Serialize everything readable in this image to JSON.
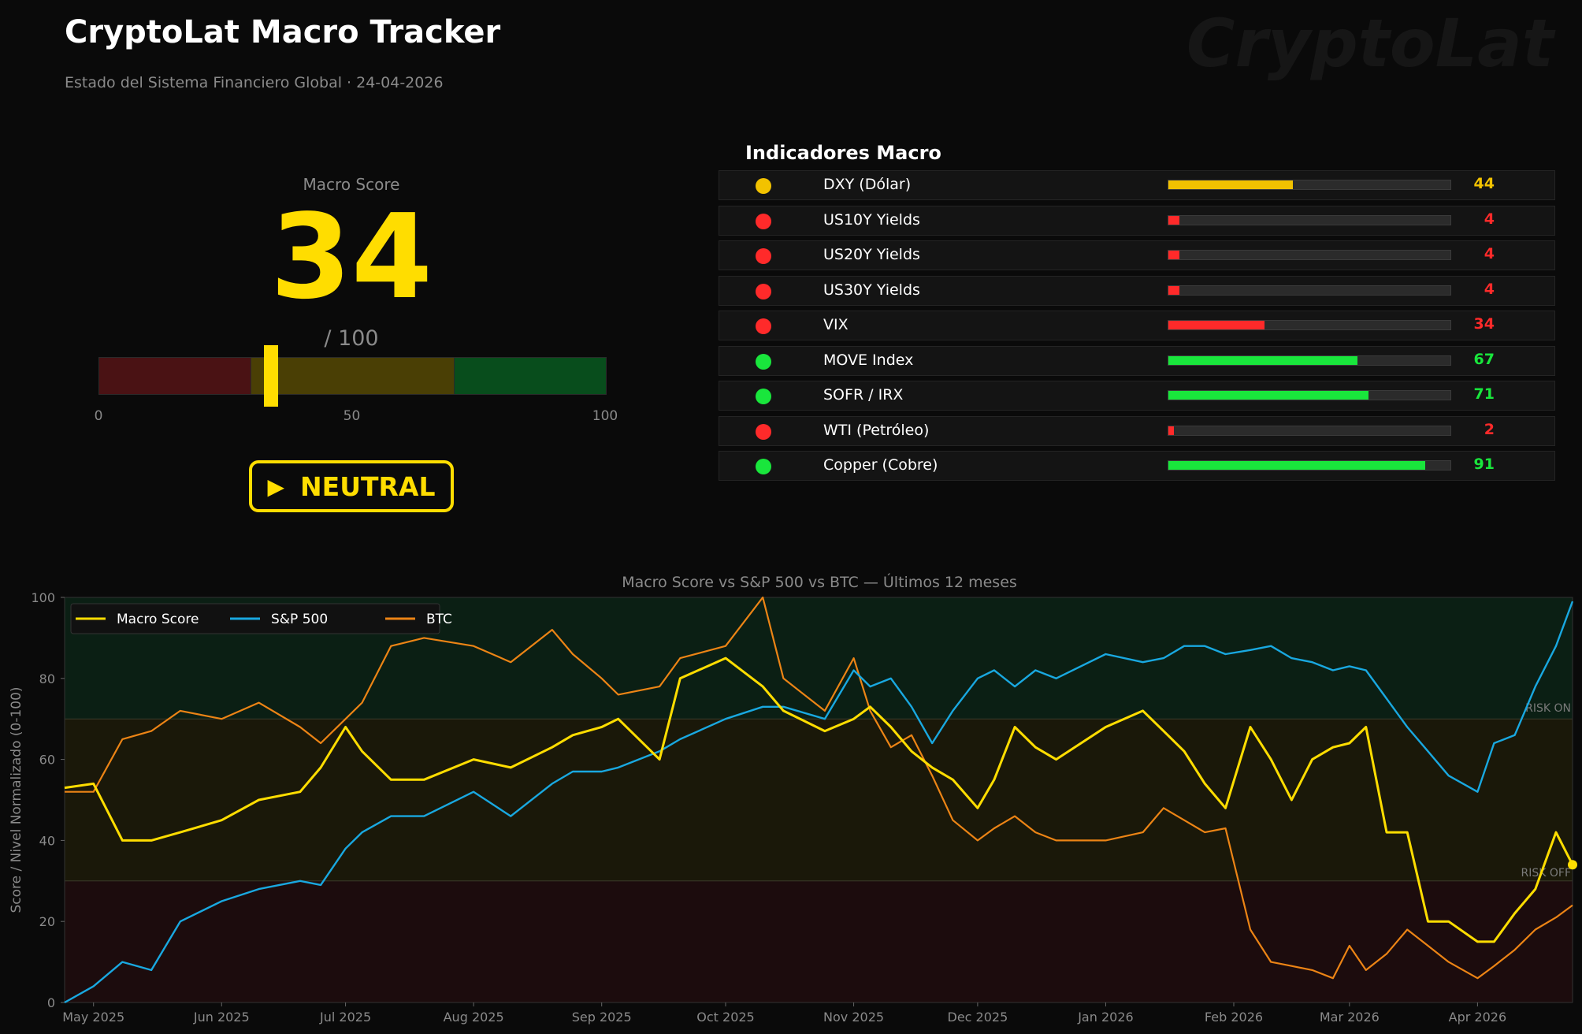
{
  "header": {
    "title": "CryptoLat Macro Tracker",
    "subtitle": "Estado del Sistema Financiero Global  ·  24-04-2026",
    "watermark": "CryptoLat"
  },
  "score": {
    "label": "Macro Score",
    "value": 34,
    "max_label": "/ 100",
    "gauge_ticks": [
      "0",
      "50",
      "100"
    ],
    "status": "NEUTRAL",
    "status_icon": "play-triangle-icon",
    "accent": "#ffdd00"
  },
  "indicators": {
    "title": "Indicadores Macro",
    "items": [
      {
        "name": "DXY (Dólar)",
        "value": 44,
        "color": "#f2c200"
      },
      {
        "name": "US10Y Yields",
        "value": 4,
        "color": "#ff2a2a"
      },
      {
        "name": "US20Y Yields",
        "value": 4,
        "color": "#ff2a2a"
      },
      {
        "name": "US30Y Yields",
        "value": 4,
        "color": "#ff2a2a"
      },
      {
        "name": "VIX",
        "value": 34,
        "color": "#ff2a2a"
      },
      {
        "name": "MOVE Index",
        "value": 67,
        "color": "#19e63c"
      },
      {
        "name": "SOFR / IRX",
        "value": 71,
        "color": "#19e63c"
      },
      {
        "name": "WTI (Petróleo)",
        "value": 2,
        "color": "#ff2a2a"
      },
      {
        "name": "Copper (Cobre)",
        "value": 91,
        "color": "#19e63c"
      }
    ]
  },
  "chart_data": {
    "type": "line",
    "title": "Macro Score vs S&P 500 vs BTC — Últimos 12 meses",
    "ylabel": "Score / Nivel Normalizado (0-100)",
    "xlabel": "",
    "ylim": [
      0,
      100
    ],
    "yticks": [
      0,
      20,
      40,
      60,
      80,
      100
    ],
    "xlim": [
      "2025-04-24",
      "2026-04-24"
    ],
    "xticks": [
      {
        "date": "2025-05-01",
        "label": "May 2025"
      },
      {
        "date": "2025-06-01",
        "label": "Jun 2025"
      },
      {
        "date": "2025-07-01",
        "label": "Jul 2025"
      },
      {
        "date": "2025-08-01",
        "label": "Aug 2025"
      },
      {
        "date": "2025-09-01",
        "label": "Sep 2025"
      },
      {
        "date": "2025-10-01",
        "label": "Oct 2025"
      },
      {
        "date": "2025-11-01",
        "label": "Nov 2025"
      },
      {
        "date": "2025-12-01",
        "label": "Dec 2025"
      },
      {
        "date": "2026-01-01",
        "label": "Jan 2026"
      },
      {
        "date": "2026-02-01",
        "label": "Feb 2026"
      },
      {
        "date": "2026-03-01",
        "label": "Mar 2026"
      },
      {
        "date": "2026-04-01",
        "label": "Apr 2026"
      }
    ],
    "zones": [
      {
        "from": 70,
        "to": 100,
        "color": "#0b1f14",
        "label": "RISK ON"
      },
      {
        "from": 30,
        "to": 70,
        "color": "#1a1809",
        "label": ""
      },
      {
        "from": 0,
        "to": 30,
        "color": "#1c0c0d",
        "label": "RISK OFF"
      }
    ],
    "legend_position": "top-left",
    "series": [
      {
        "name": "Macro Score",
        "color": "#ffdd00",
        "width": 3,
        "x": [
          "2025-04-24",
          "2025-05-01",
          "2025-05-08",
          "2025-05-15",
          "2025-05-22",
          "2025-06-01",
          "2025-06-10",
          "2025-06-20",
          "2025-06-25",
          "2025-07-01",
          "2025-07-05",
          "2025-07-12",
          "2025-07-20",
          "2025-08-01",
          "2025-08-10",
          "2025-08-20",
          "2025-08-25",
          "2025-09-01",
          "2025-09-05",
          "2025-09-15",
          "2025-09-20",
          "2025-10-01",
          "2025-10-10",
          "2025-10-15",
          "2025-10-25",
          "2025-11-01",
          "2025-11-05",
          "2025-11-10",
          "2025-11-15",
          "2025-11-20",
          "2025-11-25",
          "2025-12-01",
          "2025-12-05",
          "2025-12-10",
          "2025-12-15",
          "2025-12-20",
          "2026-01-01",
          "2026-01-10",
          "2026-01-15",
          "2026-01-20",
          "2026-01-25",
          "2026-01-30",
          "2026-02-05",
          "2026-02-10",
          "2026-02-15",
          "2026-02-20",
          "2026-02-25",
          "2026-03-01",
          "2026-03-05",
          "2026-03-10",
          "2026-03-15",
          "2026-03-20",
          "2026-03-25",
          "2026-04-01",
          "2026-04-05",
          "2026-04-10",
          "2026-04-15",
          "2026-04-20",
          "2026-04-24"
        ],
        "y": [
          53,
          54,
          40,
          40,
          42,
          45,
          50,
          52,
          58,
          68,
          62,
          55,
          55,
          60,
          58,
          63,
          66,
          68,
          70,
          60,
          80,
          85,
          78,
          72,
          67,
          70,
          73,
          68,
          62,
          58,
          55,
          48,
          55,
          68,
          63,
          60,
          68,
          72,
          67,
          62,
          54,
          48,
          68,
          60,
          50,
          60,
          63,
          64,
          68,
          42,
          42,
          20,
          20,
          15,
          15,
          22,
          28,
          42,
          34
        ]
      },
      {
        "name": "S&P 500",
        "color": "#19a8e0",
        "width": 2.4,
        "x": [
          "2025-04-24",
          "2025-05-01",
          "2025-05-08",
          "2025-05-15",
          "2025-05-22",
          "2025-06-01",
          "2025-06-10",
          "2025-06-20",
          "2025-06-25",
          "2025-07-01",
          "2025-07-05",
          "2025-07-12",
          "2025-07-20",
          "2025-08-01",
          "2025-08-10",
          "2025-08-20",
          "2025-08-25",
          "2025-09-01",
          "2025-09-05",
          "2025-09-15",
          "2025-09-20",
          "2025-10-01",
          "2025-10-10",
          "2025-10-15",
          "2025-10-25",
          "2025-11-01",
          "2025-11-05",
          "2025-11-10",
          "2025-11-15",
          "2025-11-20",
          "2025-11-25",
          "2025-12-01",
          "2025-12-05",
          "2025-12-10",
          "2025-12-15",
          "2025-12-20",
          "2026-01-01",
          "2026-01-10",
          "2026-01-15",
          "2026-01-20",
          "2026-01-25",
          "2026-01-30",
          "2026-02-05",
          "2026-02-10",
          "2026-02-15",
          "2026-02-20",
          "2026-02-25",
          "2026-03-01",
          "2026-03-05",
          "2026-03-10",
          "2026-03-15",
          "2026-03-20",
          "2026-03-25",
          "2026-04-01",
          "2026-04-05",
          "2026-04-10",
          "2026-04-15",
          "2026-04-20",
          "2026-04-24"
        ],
        "y": [
          0,
          4,
          10,
          8,
          20,
          25,
          28,
          30,
          29,
          38,
          42,
          46,
          46,
          52,
          46,
          54,
          57,
          57,
          58,
          62,
          65,
          70,
          73,
          73,
          70,
          82,
          78,
          80,
          73,
          64,
          72,
          80,
          82,
          78,
          82,
          80,
          86,
          84,
          85,
          88,
          88,
          86,
          87,
          88,
          85,
          84,
          82,
          83,
          82,
          75,
          68,
          62,
          56,
          52,
          64,
          66,
          78,
          88,
          99
        ]
      },
      {
        "name": "BTC",
        "color": "#ec8415",
        "width": 2.2,
        "x": [
          "2025-04-24",
          "2025-05-01",
          "2025-05-08",
          "2025-05-15",
          "2025-05-22",
          "2025-06-01",
          "2025-06-10",
          "2025-06-20",
          "2025-06-25",
          "2025-07-01",
          "2025-07-05",
          "2025-07-12",
          "2025-07-20",
          "2025-08-01",
          "2025-08-10",
          "2025-08-20",
          "2025-08-25",
          "2025-09-01",
          "2025-09-05",
          "2025-09-15",
          "2025-09-20",
          "2025-10-01",
          "2025-10-10",
          "2025-10-15",
          "2025-10-25",
          "2025-11-01",
          "2025-11-05",
          "2025-11-10",
          "2025-11-15",
          "2025-11-20",
          "2025-11-25",
          "2025-12-01",
          "2025-12-05",
          "2025-12-10",
          "2025-12-15",
          "2025-12-20",
          "2026-01-01",
          "2026-01-10",
          "2026-01-15",
          "2026-01-20",
          "2026-01-25",
          "2026-01-30",
          "2026-02-05",
          "2026-02-10",
          "2026-02-15",
          "2026-02-20",
          "2026-02-25",
          "2026-03-01",
          "2026-03-05",
          "2026-03-10",
          "2026-03-15",
          "2026-03-20",
          "2026-03-25",
          "2026-04-01",
          "2026-04-05",
          "2026-04-10",
          "2026-04-15",
          "2026-04-20",
          "2026-04-24"
        ],
        "y": [
          52,
          52,
          65,
          67,
          72,
          70,
          74,
          68,
          64,
          70,
          74,
          88,
          90,
          88,
          84,
          92,
          86,
          80,
          76,
          78,
          85,
          88,
          100,
          80,
          72,
          85,
          72,
          63,
          66,
          56,
          45,
          40,
          43,
          46,
          42,
          40,
          40,
          42,
          48,
          45,
          42,
          43,
          18,
          10,
          9,
          8,
          6,
          14,
          8,
          12,
          18,
          14,
          10,
          6,
          9,
          13,
          18,
          21,
          24
        ]
      }
    ]
  }
}
